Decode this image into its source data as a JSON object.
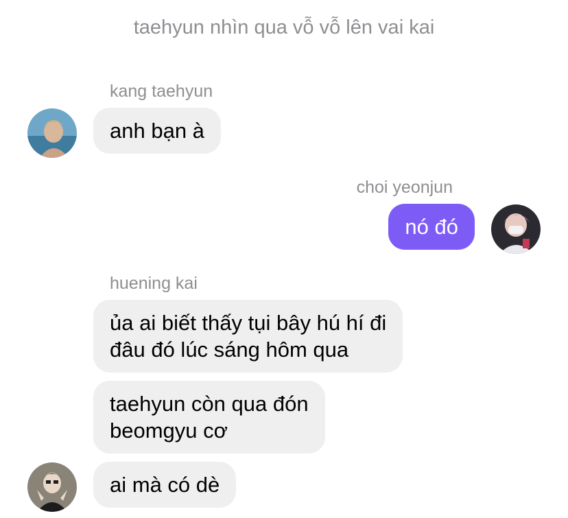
{
  "system_message": "taehyun nhìn qua vỗ vỗ lên vai kai",
  "messages": [
    {
      "sender": "kang taehyun",
      "direction": "incoming",
      "bubbles": [
        "anh bạn à"
      ]
    },
    {
      "sender": "choi yeonjun",
      "direction": "outgoing",
      "bubbles": [
        "nó đó"
      ]
    },
    {
      "sender": "huening kai",
      "direction": "incoming",
      "bubbles": [
        [
          "ủa ai biết thấy tụi bây hú hí đi",
          "đâu đó lúc sáng hôm qua"
        ],
        [
          "taehyun còn qua đón",
          "beomgyu cơ"
        ],
        [
          "ai mà có dè"
        ]
      ]
    }
  ],
  "colors": {
    "outgoing_bubble": "#7d5cf6",
    "incoming_bubble": "#efeff0",
    "meta_text": "#8e8e93"
  },
  "icons": {
    "avatar_taehyun": "profile-photo",
    "avatar_yeonjun": "profile-photo",
    "avatar_kai": "profile-photo"
  }
}
